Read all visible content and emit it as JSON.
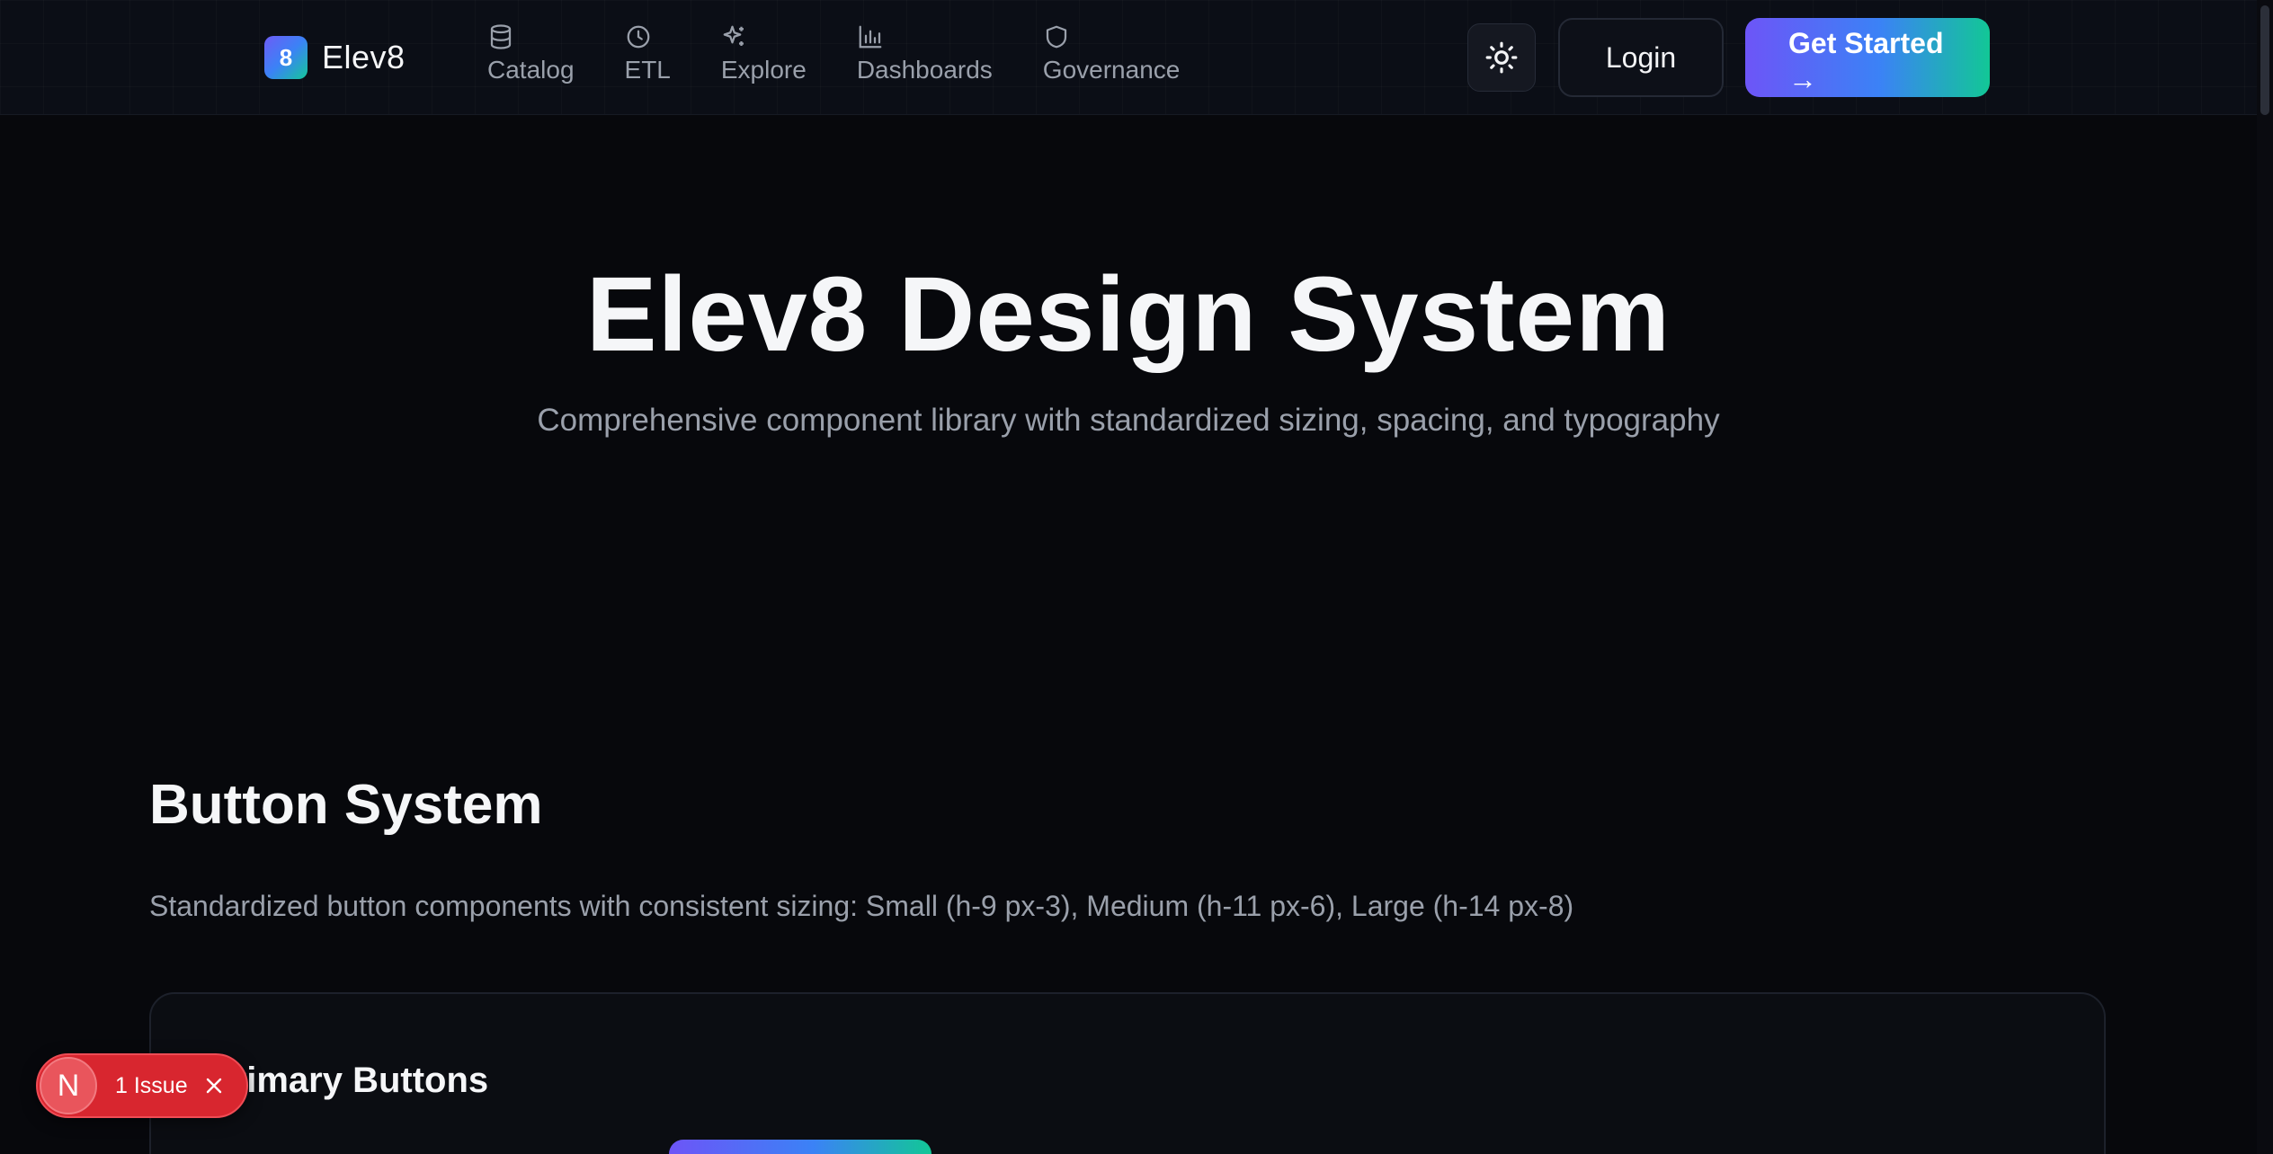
{
  "header": {
    "brand_mark": "8",
    "brand_name": "Elev8",
    "nav": [
      {
        "label": "Catalog",
        "icon": "database-icon"
      },
      {
        "label": "ETL",
        "icon": "clock-icon"
      },
      {
        "label": "Explore",
        "icon": "sparkles-icon"
      },
      {
        "label": "Dashboards",
        "icon": "bar-chart-icon"
      },
      {
        "label": "Governance",
        "icon": "shield-icon"
      }
    ],
    "theme_icon": "sun-icon",
    "login_label": "Login",
    "cta_label": "Get Started",
    "cta_icon": "→"
  },
  "hero": {
    "title": "Elev8 Design System",
    "subtitle": "Comprehensive component library with standardized sizing, spacing, and typography"
  },
  "section": {
    "title": "Button System",
    "description": "Standardized button components with consistent sizing: Small (h-9 px-3), Medium (h-11 px-6), Large (h-14 px-8)",
    "card_title": "Primary Buttons"
  },
  "issue_badge": {
    "logo": "N",
    "label": "1 Issue"
  },
  "colors": {
    "background": "#07080c",
    "accent_start": "#6d55f7",
    "accent_end": "#12c796",
    "issue_red": "#d8262f"
  }
}
